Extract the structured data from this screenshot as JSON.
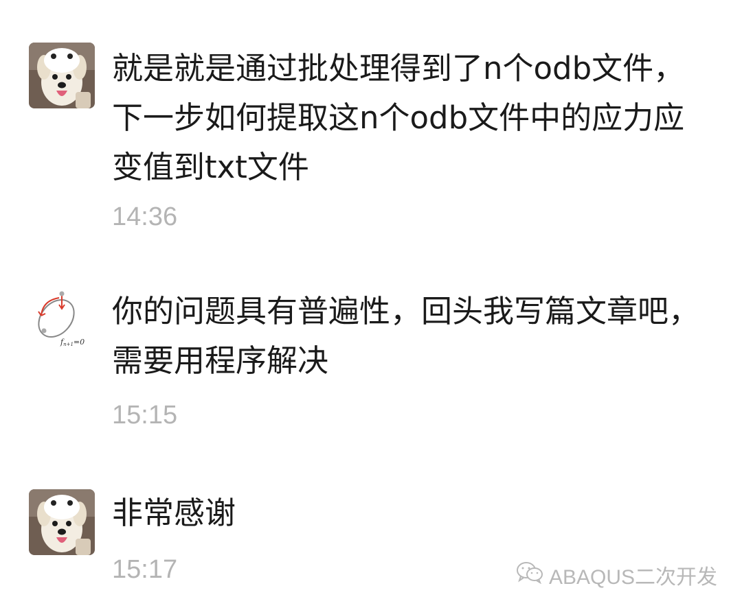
{
  "messages": [
    {
      "sender": "dog",
      "text": "就是就是通过批处理得到了n个odb文件，下一步如何提取这n个odb文件中的应力应变值到txt文件",
      "time": "14:36"
    },
    {
      "sender": "author",
      "text": "你的问题具有普遍性，回头我写篇文章吧，需要用程序解决",
      "time": "15:15"
    },
    {
      "sender": "dog",
      "text": "非常感谢",
      "time": "15:17"
    }
  ],
  "author_avatar": {
    "formula": "f",
    "formula_sub": "n+1",
    "formula_tail": "=0"
  },
  "watermark": {
    "icon": "wechat-icon",
    "text": "ABAQUS二次开发"
  },
  "colors": {
    "text": "#1a1a1a",
    "time": "#b4b4b4",
    "watermark": "#b8b8b8",
    "avatar_bg": "#7a6a5c",
    "arrow": "#d93a2b"
  }
}
